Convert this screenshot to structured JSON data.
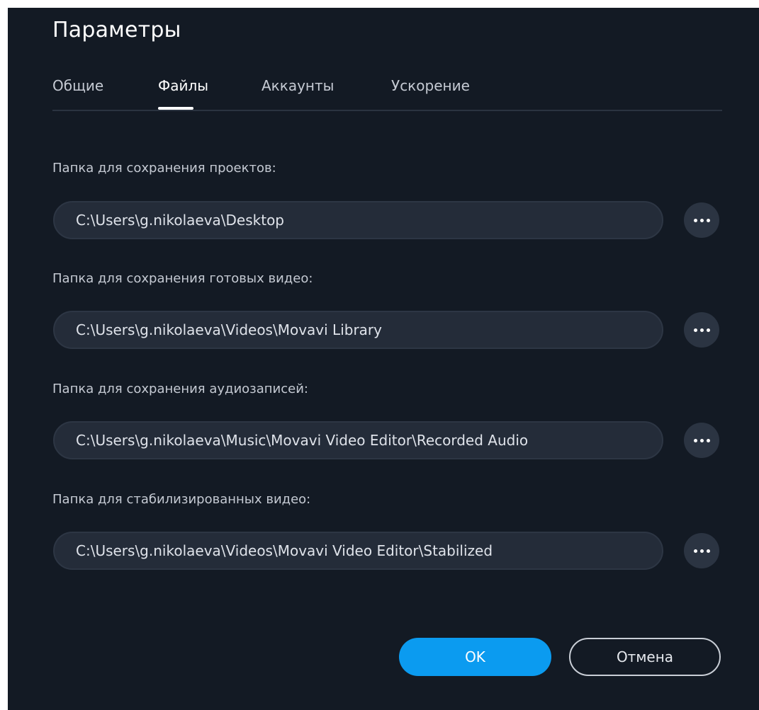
{
  "dialog": {
    "title": "Параметры"
  },
  "tabs": [
    {
      "label": "Общие",
      "active": false
    },
    {
      "label": "Файлы",
      "active": true
    },
    {
      "label": "Аккаунты",
      "active": false
    },
    {
      "label": "Ускорение",
      "active": false
    }
  ],
  "folders": [
    {
      "label": "Папка для сохранения проектов:",
      "value": "C:\\Users\\g.nikolaeva\\Desktop"
    },
    {
      "label": "Папка для сохранения готовых видео:",
      "value": "C:\\Users\\g.nikolaeva\\Videos\\Movavi Library"
    },
    {
      "label": "Папка для сохранения аудиозаписей:",
      "value": "C:\\Users\\g.nikolaeva\\Music\\Movavi Video Editor\\Recorded Audio"
    },
    {
      "label": "Папка для стабилизированных видео:",
      "value": "C:\\Users\\g.nikolaeva\\Videos\\Movavi Video Editor\\Stabilized"
    }
  ],
  "browse_icon": "more-dots-icon",
  "buttons": {
    "ok": "OK",
    "cancel": "Отмена"
  },
  "colors": {
    "background": "#131a24",
    "accent": "#0b9bf0",
    "field": "#242c39"
  }
}
